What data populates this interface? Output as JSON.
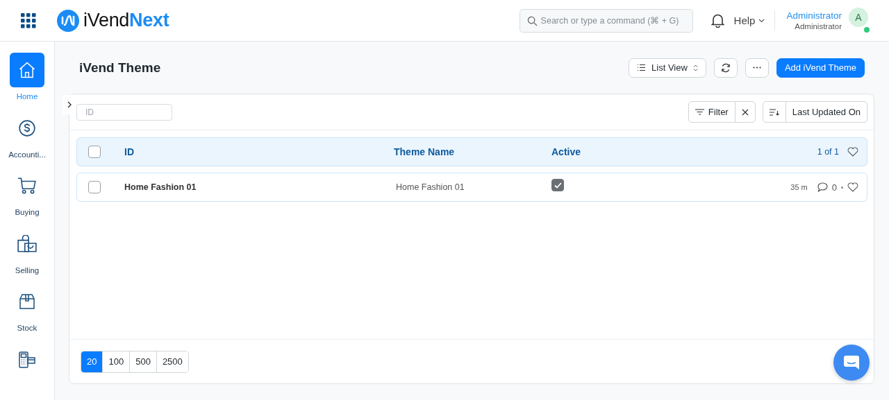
{
  "header": {
    "brand_prefix": "iVend",
    "brand_suffix": "Next",
    "search": {
      "placeholder": "Search or type a command (⌘ + G)"
    },
    "help": "Help",
    "user": {
      "name": "Administrator",
      "role": "Administrator",
      "avatar": "A",
      "online": true
    }
  },
  "sidebar": {
    "items": [
      {
        "kind": "home",
        "label": "Home",
        "selected": true
      },
      {
        "kind": "accounting",
        "label": "Accounti...",
        "selected": false
      },
      {
        "kind": "buying",
        "label": "Buying",
        "selected": false
      },
      {
        "kind": "selling",
        "label": "Selling",
        "selected": false
      },
      {
        "kind": "stock",
        "label": "Stock",
        "selected": false
      },
      {
        "kind": "retail",
        "selected": false
      }
    ]
  },
  "page": {
    "title": "iVend Theme",
    "view_button": "List View",
    "primary_button": "Add iVend Theme"
  },
  "list": {
    "id_filter": {
      "placeholder": "ID"
    },
    "filter_button": "Filter",
    "sort_button": "Last Updated On",
    "all_selected": false,
    "columns": [
      "ID",
      "Theme Name",
      "Active"
    ],
    "count": "1 of 1",
    "rows": [
      {
        "id": "Home Fashion 01",
        "theme_name": "Home Fashion 01",
        "active": true,
        "selected": false,
        "modified": "35 m",
        "comments": "0",
        "liked": false
      }
    ],
    "page_sizes": [
      {
        "label": "20",
        "selected": true
      },
      {
        "label": "100",
        "selected": false
      },
      {
        "label": "500",
        "selected": false
      },
      {
        "label": "2500",
        "selected": false
      }
    ]
  }
}
